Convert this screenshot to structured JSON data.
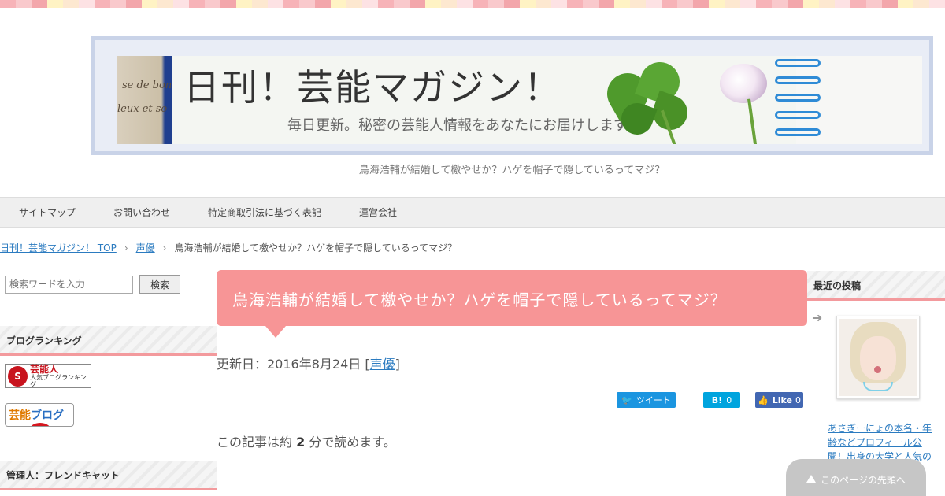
{
  "site": {
    "title": "日刊！芸能マガジン！",
    "subtitle": "毎日更新。秘密の芸能人情報をあなたにお届けします。",
    "tagline": "鳥海浩輔が結婚して檄やせか？ハゲを帽子で隠しているってマジ？"
  },
  "nav": [
    "サイトマップ",
    "お問い合わせ",
    "特定商取引法に基づく表記",
    "運営会社"
  ],
  "breadcrumb": {
    "home": "日刊！芸能マガジン！ TOP",
    "category": "声優",
    "current": "鳥海浩輔が結婚して檄やせか？ハゲを帽子で隠しているってマジ？"
  },
  "search": {
    "placeholder": "検索ワードを入力",
    "button": "検索"
  },
  "left_sidebar": {
    "ranking_heading": "ブログランキング",
    "ranking_badge_1_title": "芸能人",
    "ranking_badge_1_sub": "人気ブログランキング",
    "ranking_badge_2_a": "芸能",
    "ranking_badge_2_b": "ブログ",
    "admin_heading": "管理人：フレンドキャット"
  },
  "post": {
    "title": "鳥海浩輔が結婚して檄やせか？ハゲを帽子で隠しているってマジ？",
    "updated_label": "更新日：2016年8月24日",
    "category": "声優",
    "read_prefix": "この記事は約",
    "read_minutes": "2",
    "read_suffix": "分で読めます。"
  },
  "share": {
    "tweet": "ツイート",
    "hatena_count": "0",
    "fb_label": "Like",
    "fb_count": "0"
  },
  "right_sidebar": {
    "recent_heading": "最近の投稿",
    "recent_link": "あさぎーにょの本名・年齢などプロフィール公開！出身の大学と人気の"
  },
  "to_top": "このページの先頭へ",
  "colors": {
    "accent": "#f79596",
    "link": "#2b7bc0",
    "nav_bg": "#efefef"
  }
}
